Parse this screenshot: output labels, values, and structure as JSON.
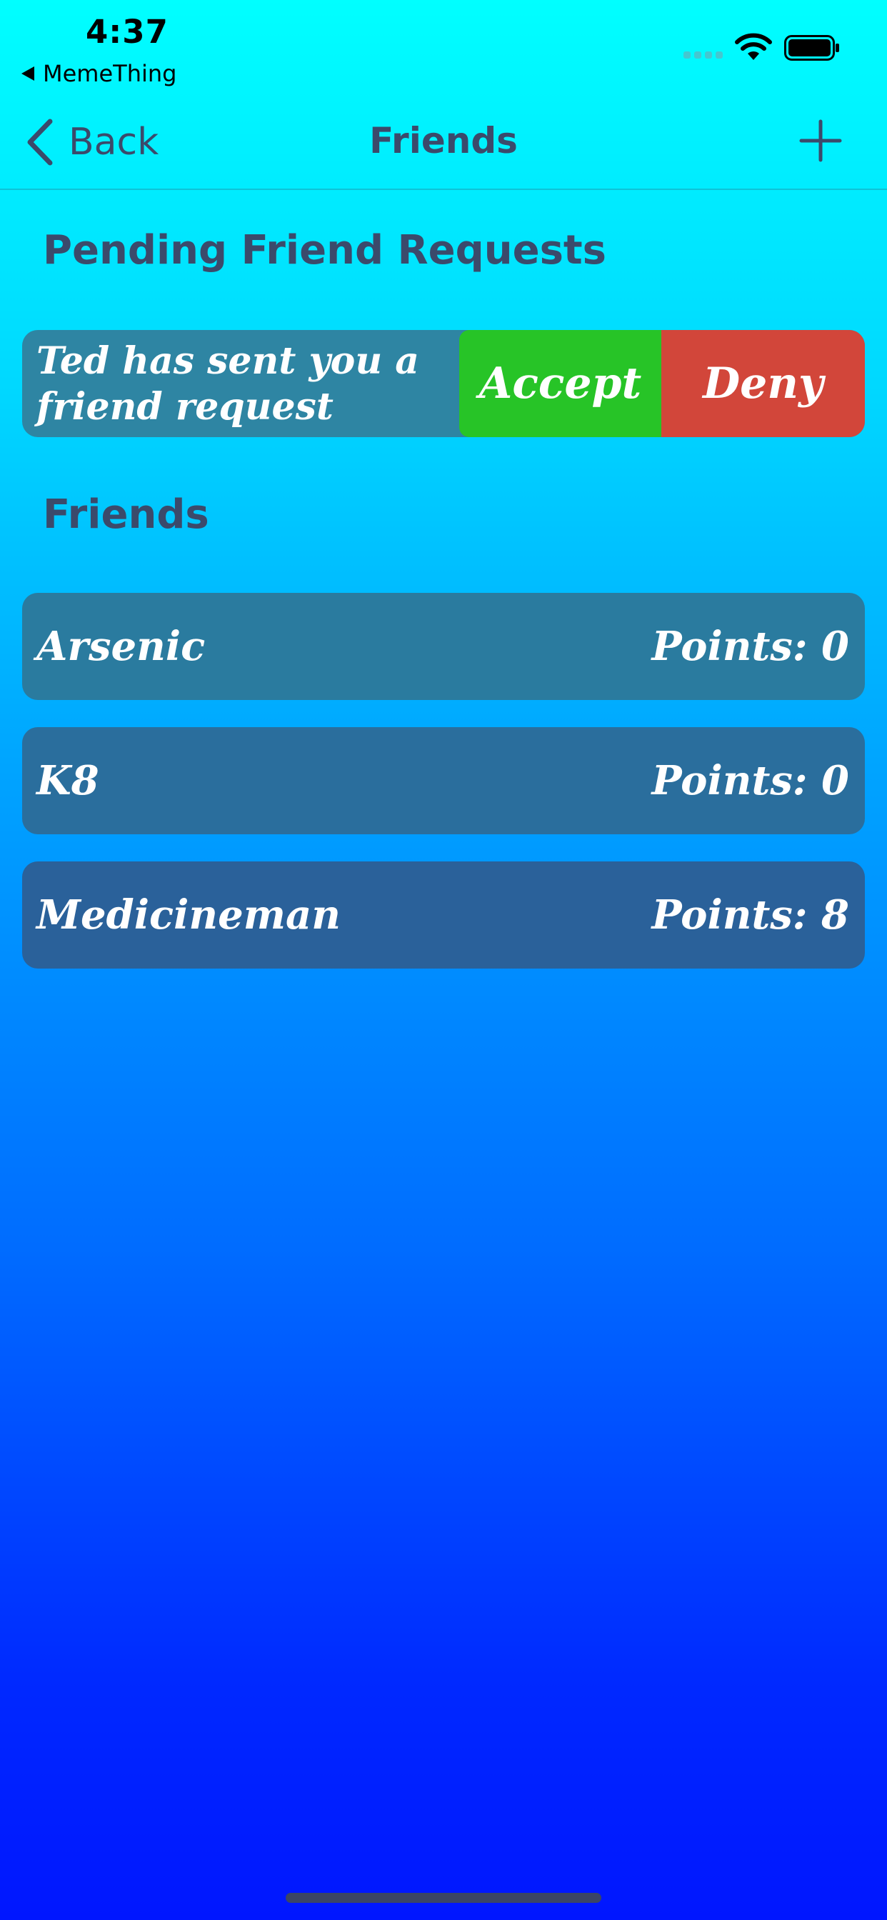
{
  "status_bar": {
    "time": "4:37",
    "back_app_label": "MemeThing",
    "signal_icon": "signal-icon",
    "wifi_icon": "wifi-icon",
    "battery_icon": "battery-icon"
  },
  "nav": {
    "back_label": "Back",
    "title": "Friends",
    "add_icon": "plus-icon"
  },
  "pending": {
    "heading": "Pending Friend Requests",
    "requests": [
      {
        "text": "Ted has sent you a friend request",
        "accept_label": "Accept",
        "deny_label": "Deny"
      }
    ]
  },
  "friends": {
    "heading": "Friends",
    "items": [
      {
        "name": "Arsenic",
        "points": "Points: 0"
      },
      {
        "name": "K8",
        "points": "Points: 0"
      },
      {
        "name": "Medicineman",
        "points": "Points: 8"
      }
    ]
  },
  "colors": {
    "gradient_top": "#00FFFF",
    "gradient_bottom": "#0016FF",
    "accept": "#27C427",
    "deny": "#D2463A",
    "heading_text": "#3B4A6B"
  }
}
